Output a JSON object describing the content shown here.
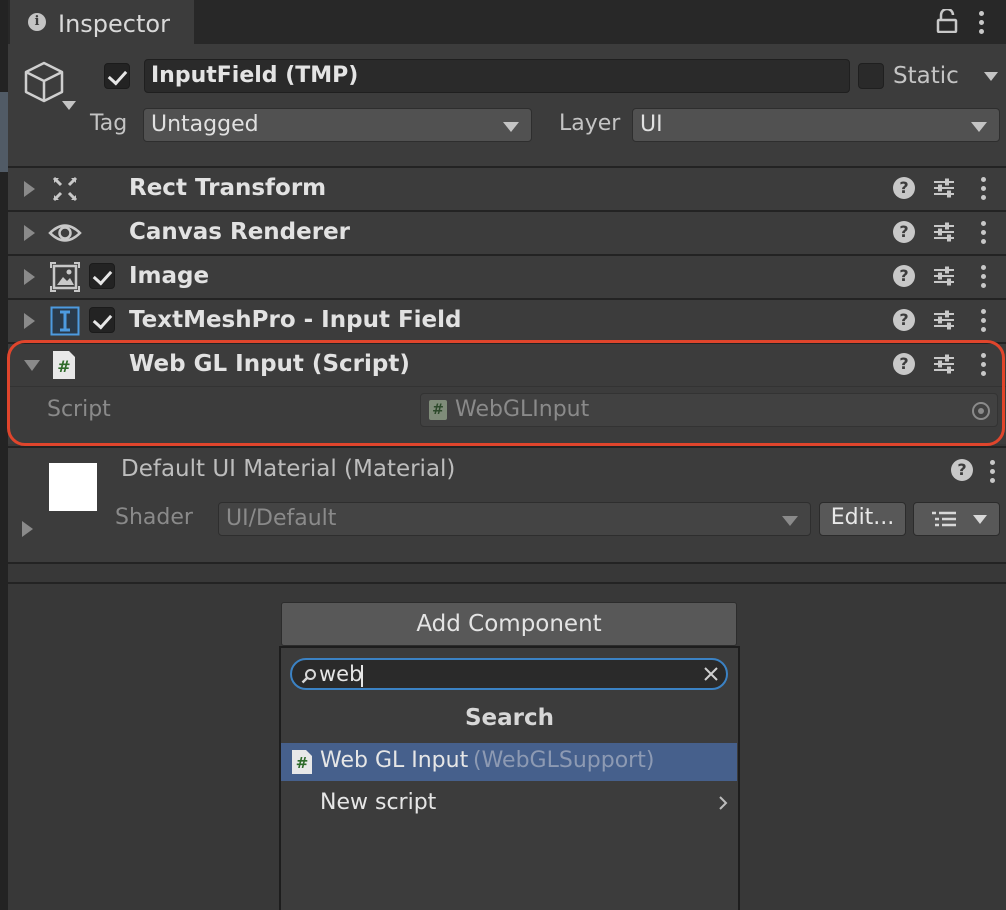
{
  "window": {
    "tab_title": "Inspector"
  },
  "header": {
    "object_name": "InputField (TMP)",
    "static_label": "Static",
    "tag_label": "Tag",
    "tag_value": "Untagged",
    "layer_label": "Layer",
    "layer_value": "UI"
  },
  "components": [
    {
      "name": "Rect Transform",
      "icon": "rect-transform-icon",
      "has_checkbox": false
    },
    {
      "name": "Canvas Renderer",
      "icon": "eye-icon",
      "has_checkbox": false
    },
    {
      "name": "Image",
      "icon": "image-icon",
      "has_checkbox": true,
      "checked": true
    },
    {
      "name": "TextMeshPro - Input Field",
      "icon": "text-cursor-icon",
      "has_checkbox": true,
      "checked": true
    },
    {
      "name": "Web GL Input (Script)",
      "icon": "script-icon",
      "has_checkbox": false,
      "expanded": true
    }
  ],
  "webgl_component": {
    "script_label": "Script",
    "script_value": "WebGLInput"
  },
  "material": {
    "name": "Default UI Material (Material)",
    "shader_label": "Shader",
    "shader_value": "UI/Default",
    "edit_label": "Edit..."
  },
  "add_component": {
    "button_label": "Add Component",
    "search_value": "web",
    "section_title": "Search",
    "results": [
      {
        "name": "Web GL Input",
        "suffix": "(WebGLSupport)",
        "selected": true
      },
      {
        "name": "New script",
        "submenu": true
      }
    ]
  },
  "colors": {
    "highlight_border": "#e0452c",
    "selection": "#46608c",
    "search_focus": "#3b82c4"
  }
}
